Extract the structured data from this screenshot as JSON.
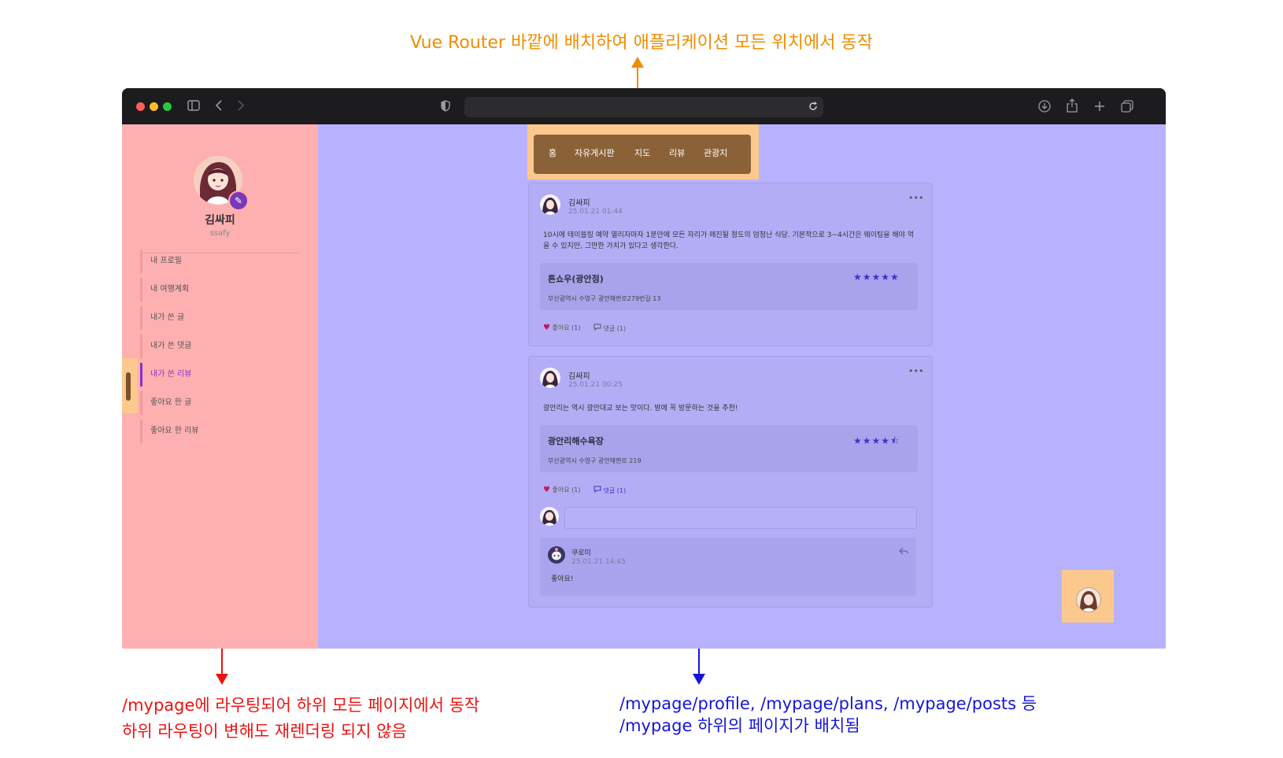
{
  "annotations": {
    "top": "Vue Router 바깥에 배치하여 애플리케이션 모든 위치에서 동작",
    "left_line1": "/mypage에 라우팅되어 하위 모든 페이지에서 동작",
    "left_line2": "하위 라우팅이 변해도 재렌더링 되지 않음",
    "right_line1": "/mypage/profile, /mypage/plans, /mypage/posts 등",
    "right_line2": "/mypage 하위의 페이지가 배치됨"
  },
  "colors": {
    "orange": "#f08c00",
    "red": "#ee1111",
    "blue": "#1515d9",
    "sidebar_bg": "#feb0b0",
    "content_bg": "#b8b2fe",
    "highlight": "#fbc98d",
    "nav_bg": "#8b6238",
    "active": "#8b2fc9"
  },
  "profile": {
    "name": "김싸피",
    "id": "ssafy"
  },
  "sidebar": {
    "items": [
      "내 프로필",
      "내 여행계획",
      "내가 쓴 글",
      "내가 쓴 댓글",
      "내가 쓴 리뷰",
      "좋아요 한 글",
      "좋아요 한 리뷰"
    ],
    "active_index": 4
  },
  "nav": {
    "items": [
      "홈",
      "자유게시판",
      "지도",
      "리뷰",
      "관광지"
    ]
  },
  "posts": [
    {
      "author": "김싸피",
      "date": "25.01.21 01:44",
      "text_line1": "10시에 테이블링 예약 열리자마자 1분안에 모든 자리가 매진될 정도의 엄청난 식당. 기본적으로 3~4시간은 웨이팅을 해야 먹",
      "text_line2": "을 수 있지만, 그만한 가치가 있다고 생각한다.",
      "place_name": "톤쇼우(광안점)",
      "place_address": "부산광역시 수영구 광안해변로279번길 13",
      "rating": 5,
      "stars": "★★★★★",
      "likes": "좋아요 (1)",
      "comments": "댓글 (1)"
    },
    {
      "author": "김싸피",
      "date": "25.01.21 00:25",
      "text": "광안리는 역시 광안대교 보는 맛이다. 밤에 꼭 방문하는 것을 추천!",
      "place_name": "광안리해수욕장",
      "place_address": "부산광역시 수영구 광안해변로 219",
      "rating": 4.5,
      "stars": "★★★★⯪",
      "likes": "좋아요 (1)",
      "comments": "댓글 (1)",
      "reply": {
        "author": "쿠로미",
        "date": "25.01.21 14:45",
        "text": "좋아요!"
      }
    }
  ],
  "icons": [
    "sidebar-icon",
    "back-icon",
    "forward-icon",
    "shield-icon",
    "reload-icon",
    "download-icon",
    "share-icon",
    "plus-icon",
    "tabs-icon",
    "edit-icon",
    "heart-icon",
    "comment-icon",
    "more-icon",
    "reply-icon"
  ]
}
